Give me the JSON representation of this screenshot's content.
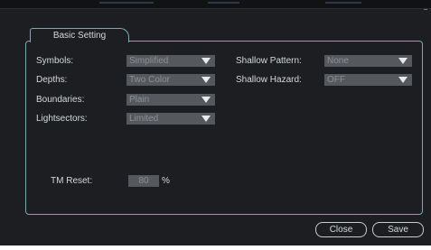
{
  "dialog": {
    "tab_label": "Basic Setting",
    "fields": {
      "symbols": {
        "label": "Symbols:",
        "value": "Simplified"
      },
      "depths": {
        "label": "Depths:",
        "value": "Two Color"
      },
      "boundaries": {
        "label": "Boundaries:",
        "value": "Plain"
      },
      "lightsectors": {
        "label": "Lightsectors:",
        "value": "Limited"
      },
      "shallow_pattern": {
        "label": "Shallow Pattern:",
        "value": "None"
      },
      "shallow_hazard": {
        "label": "Shallow Hazard:",
        "value": "OFF"
      },
      "tm_reset": {
        "label": "TM Reset:",
        "value": "80",
        "unit": "%"
      }
    },
    "buttons": {
      "close": "Close",
      "save": "Save"
    }
  },
  "colors": {
    "background": "#1c1e21",
    "border_accent": "#7fa6b4",
    "control_fill": "#55595e"
  }
}
